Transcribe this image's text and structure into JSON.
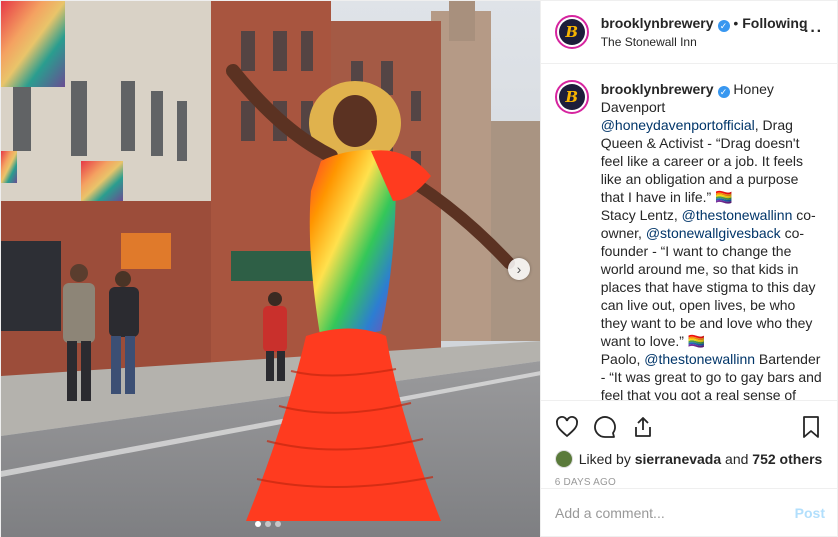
{
  "header": {
    "username": "brooklynbrewery",
    "separator": "•",
    "follow_status": "Following",
    "location": "The Stonewall Inn",
    "more_icon": "ellipsis-icon",
    "avatar_letter": "B"
  },
  "caption": {
    "username": "brooklynbrewery",
    "segments": [
      {
        "type": "text",
        "text": "Honey Davenport "
      },
      {
        "type": "mention",
        "text": "@honeydavenportofficial"
      },
      {
        "type": "text",
        "text": ", Drag Queen & Activist - “Drag doesn't feel like a career or a job. It feels like an obligation and a purpose that I have in life.” 🏳️‍🌈"
      },
      {
        "type": "br"
      },
      {
        "type": "text",
        "text": "Stacy Lentz, "
      },
      {
        "type": "mention",
        "text": "@thestonewallinn"
      },
      {
        "type": "text",
        "text": " co-owner, "
      },
      {
        "type": "mention",
        "text": "@stonewallgivesback"
      },
      {
        "type": "text",
        "text": " co-founder - “I want to change the world around me, so that kids in places that have stigma to this day can live out, open lives, be who they want to be and love who they want to love.” 🏳️‍🌈"
      },
      {
        "type": "br"
      },
      {
        "type": "text",
        "text": "Paolo, "
      },
      {
        "type": "mention",
        "text": "@thestonewallinn"
      },
      {
        "type": "text",
        "text": " Bartender - “It was great to go to gay bars and feel that you got a real sense of these people, and that no one was hiding anything. They're just being"
      }
    ]
  },
  "actions": {
    "like_icon": "heart-icon",
    "comment_icon": "comment-icon",
    "share_icon": "share-icon",
    "save_icon": "bookmark-icon"
  },
  "likes": {
    "prefix": "Liked by ",
    "user": "sierranevada",
    "middle": " and ",
    "others": "752 others"
  },
  "timestamp": "6 DAYS AGO",
  "comment_box": {
    "placeholder": "Add a comment...",
    "post_label": "Post"
  },
  "carousel": {
    "next_icon": "chevron-right-icon",
    "next_glyph": "›",
    "slides": 3,
    "active_index": 0
  },
  "colors": {
    "accent": "#3897f0",
    "mention": "#003569",
    "post_disabled": "#b2dffc",
    "muted": "#999999"
  }
}
